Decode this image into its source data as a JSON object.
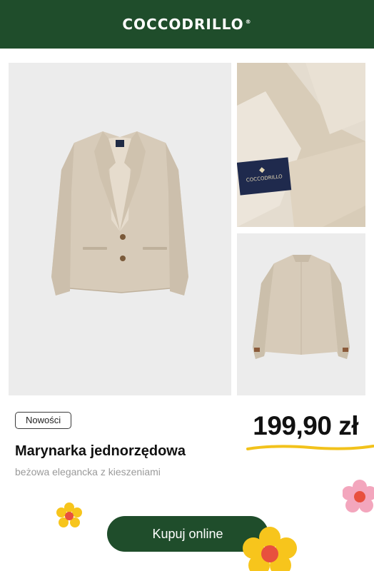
{
  "header": {
    "logo_text": "COCCODRILLO",
    "logo_mark": "®",
    "background": "#1f4d2b"
  },
  "gallery": [
    {
      "name": "blazer front",
      "icon": "jacket-front-image"
    },
    {
      "name": "blazer label detail",
      "icon": "jacket-label-image",
      "label_text": "COCCODRILLO"
    },
    {
      "name": "blazer back",
      "icon": "jacket-back-image"
    }
  ],
  "product": {
    "badge": "Nowości",
    "price": "199,90 zł",
    "title": "Marynarka jednorzędowa",
    "subtitle": "beżowa elegancka z kieszeniami"
  },
  "cta": {
    "label": "Kupuj online"
  },
  "colors": {
    "accent_green": "#1f4d2b",
    "underline_yellow": "#f2c21b",
    "flower_pink": "#f3a6bd",
    "flower_yellow": "#f7c51c",
    "flower_center": "#e8503e"
  }
}
